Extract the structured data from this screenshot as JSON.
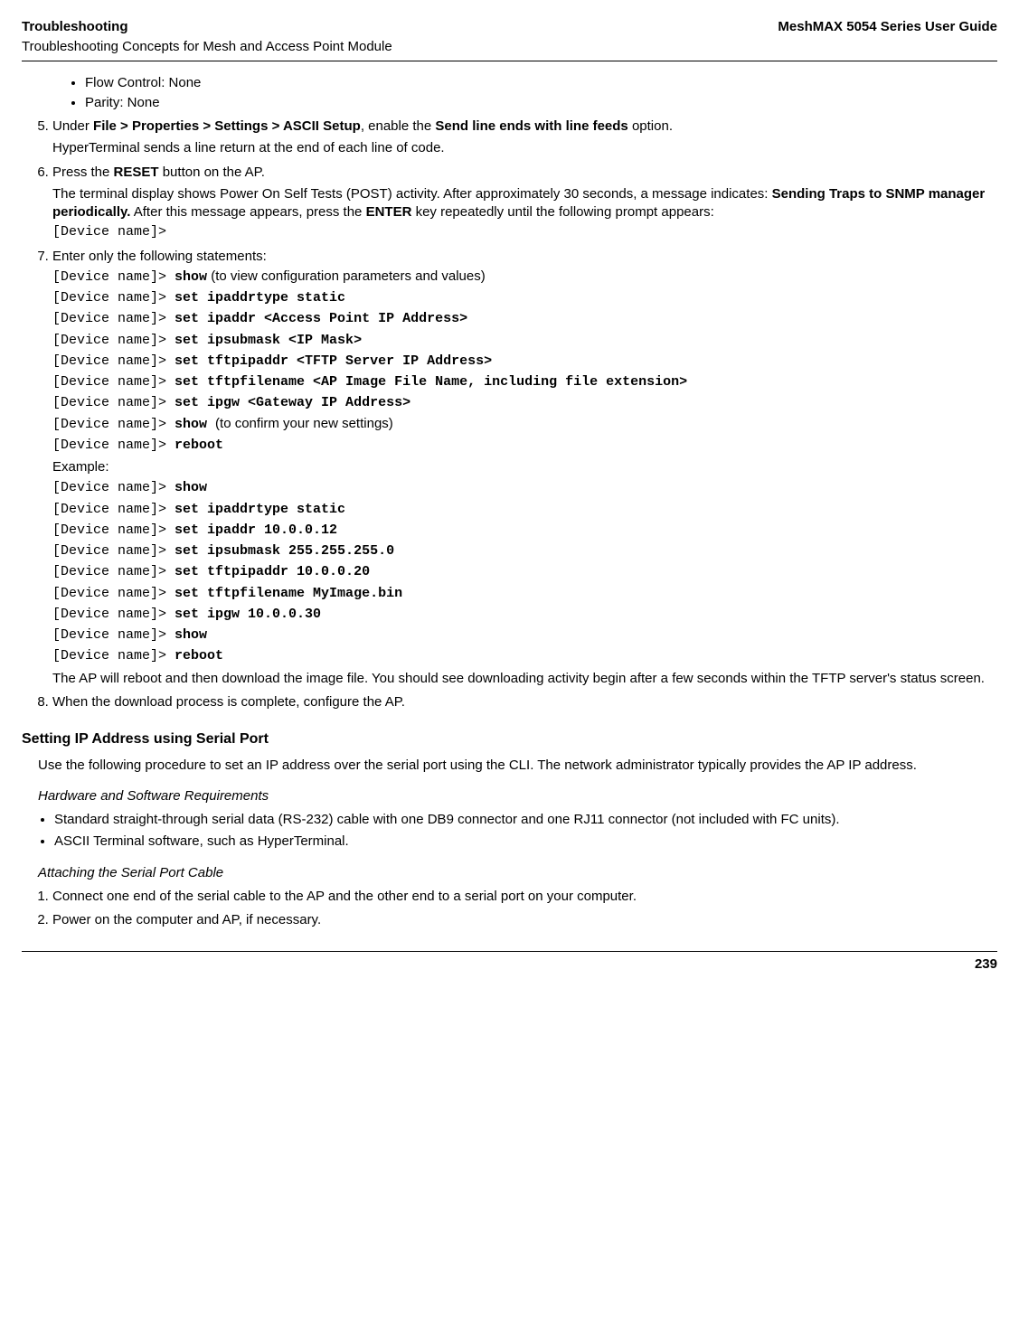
{
  "header": {
    "left_title": "Troubleshooting",
    "left_sub": "Troubleshooting Concepts for Mesh and Access Point Module",
    "right_title": "MeshMAX 5054 Series User Guide"
  },
  "top_bullets": [
    "Flow Control: None",
    "Parity: None"
  ],
  "step5": {
    "pre": "Under ",
    "bold_path": "File > Properties > Settings > ASCII Setup",
    "mid": ", enable the ",
    "bold_opt": "Send line ends with line feeds",
    "post": " option.",
    "line2": "HyperTerminal sends a line return at the end of each line of code."
  },
  "step6": {
    "pre": "Press the ",
    "bold_reset": "RESET",
    "post": " button on the AP.",
    "line2a": "The terminal display shows Power On Self Tests (POST) activity. After approximately 30 seconds, a message indicates: ",
    "bold_msg": "Sending Traps to SNMP manager periodically.",
    "line2b": " After this message appears, press the ",
    "bold_enter": "ENTER",
    "line2c": " key repeatedly until the following prompt appears:",
    "prompt": "[Device name]>"
  },
  "step7": {
    "intro": "Enter only the following statements:",
    "lines": [
      {
        "p": "[Device name]> ",
        "c": "show",
        "t": " (to view configuration parameters and values)"
      },
      {
        "p": "[Device name]> ",
        "c": "set ipaddrtype static",
        "t": ""
      },
      {
        "p": "[Device name]> ",
        "c": "set ipaddr <Access Point IP Address>",
        "t": ""
      },
      {
        "p": "[Device name]> ",
        "c": "set ipsubmask <IP Mask>",
        "t": ""
      },
      {
        "p": "[Device name]> ",
        "c": "set tftpipaddr <TFTP Server IP Address>",
        "t": ""
      },
      {
        "p": "[Device name]> ",
        "c": "set tftpfilename <AP Image File Name, including file extension>",
        "t": ""
      },
      {
        "p": "[Device name]> ",
        "c": "set ipgw <Gateway IP Address>",
        "t": ""
      },
      {
        "p": "[Device name]> ",
        "c": "show ",
        "t": " (to confirm your new settings)"
      },
      {
        "p": "[Device name]> ",
        "c": "reboot",
        "t": ""
      }
    ],
    "example_label": "Example:",
    "example_lines": [
      {
        "p": "[Device name]> ",
        "c": "show"
      },
      {
        "p": "[Device name]> ",
        "c": "set ipaddrtype static"
      },
      {
        "p": "[Device name]> ",
        "c": "set ipaddr 10.0.0.12"
      },
      {
        "p": "[Device name]> ",
        "c": "set ipsubmask 255.255.255.0"
      },
      {
        "p": "[Device name]> ",
        "c": "set tftpipaddr 10.0.0.20"
      },
      {
        "p": "[Device name]> ",
        "c": "set tftpfilename MyImage.bin"
      },
      {
        "p": "[Device name]> ",
        "c": "set ipgw 10.0.0.30"
      },
      {
        "p": "[Device name]> ",
        "c": "show"
      },
      {
        "p": "[Device name]> ",
        "c": "reboot"
      }
    ],
    "after": "The AP will reboot and then download the image file. You should see downloading activity begin after a few seconds within the TFTP server's status screen."
  },
  "step8": "When the download process is complete, configure the AP.",
  "sec_ip": {
    "title": "Setting IP Address using Serial Port",
    "para": "Use the following procedure to set an IP address over the serial port using the CLI. The network administrator typically provides the AP IP address."
  },
  "sec_hw": {
    "title": "Hardware and Software Requirements",
    "bullets": [
      "Standard straight-through serial data (RS-232) cable with one DB9 connector and one RJ11 connector (not included with FC units).",
      "ASCII Terminal software, such as HyperTerminal."
    ]
  },
  "sec_attach": {
    "title": "Attaching the Serial Port Cable",
    "steps": [
      "Connect one end of the serial cable to the AP and the other end to a serial port on your computer.",
      "Power on the computer and AP, if necessary."
    ]
  },
  "page_number": "239"
}
